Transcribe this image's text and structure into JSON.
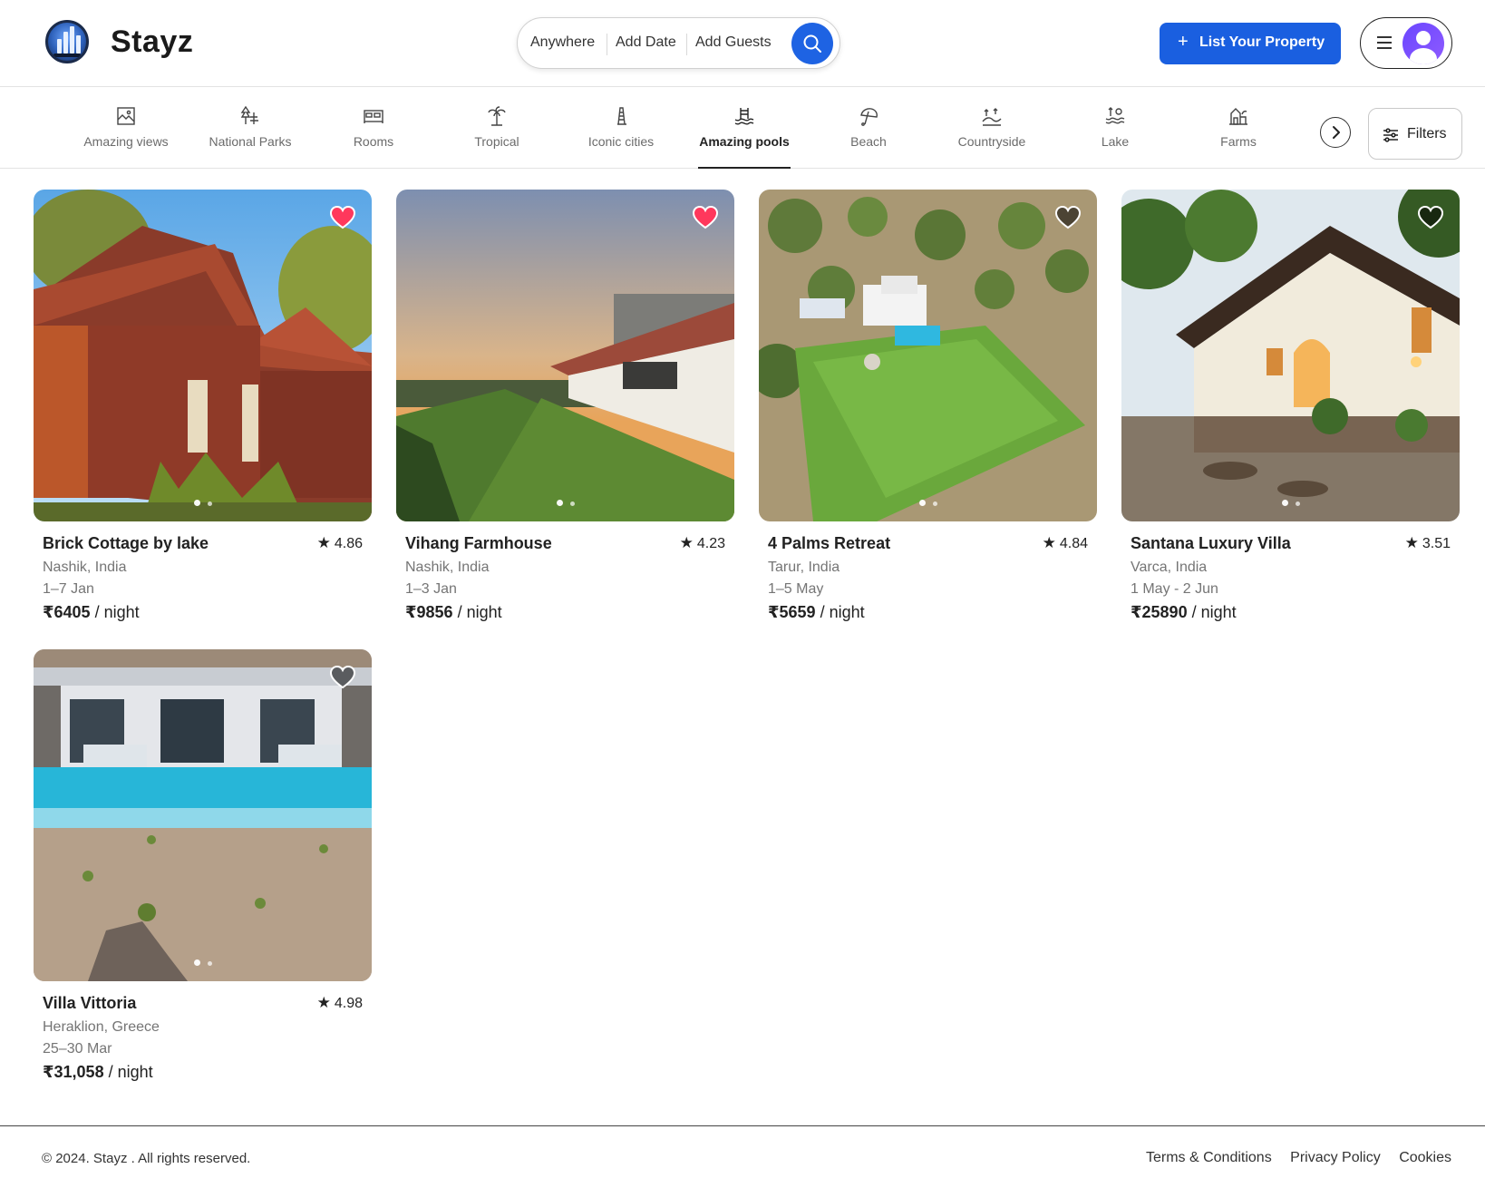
{
  "header": {
    "brand": "Stayz",
    "search": {
      "where": "Anywhere",
      "date": "Add Date",
      "guests": "Add Guests"
    },
    "list_property": "List Your Property"
  },
  "categories": [
    {
      "label": "Amazing views",
      "icon": "picture-icon"
    },
    {
      "label": "National Parks",
      "icon": "trees-icon"
    },
    {
      "label": "Rooms",
      "icon": "bed-icon"
    },
    {
      "label": "Tropical",
      "icon": "palm-icon"
    },
    {
      "label": "Iconic cities",
      "icon": "tower-icon"
    },
    {
      "label": "Amazing pools",
      "icon": "pool-icon",
      "active": true
    },
    {
      "label": "Beach",
      "icon": "umbrella-icon"
    },
    {
      "label": "Countryside",
      "icon": "hills-icon"
    },
    {
      "label": "Lake",
      "icon": "lake-icon"
    },
    {
      "label": "Farms",
      "icon": "farm-icon"
    }
  ],
  "filters_label": "Filters",
  "listings": [
    {
      "title": "Brick Cottage by lake",
      "rating": "4.86",
      "location": "Nashik, India",
      "dates": "1–7 Jan",
      "price": "₹6405",
      "per": " / night",
      "favorite": true
    },
    {
      "title": "Vihang Farmhouse",
      "rating": "4.23",
      "location": "Nashik, India",
      "dates": "1–3 Jan",
      "price": "₹9856",
      "per": " / night",
      "favorite": true
    },
    {
      "title": "4 Palms Retreat",
      "rating": "4.84",
      "location": "Tarur, India",
      "dates": "1–5 May",
      "price": "₹5659",
      "per": " / night",
      "favorite": false
    },
    {
      "title": "Santana Luxury Villa",
      "rating": "3.51",
      "location": "Varca, India",
      "dates": "1 May - 2 Jun",
      "price": "₹25890",
      "per": " / night",
      "favorite": false
    },
    {
      "title": "Villa Vittoria",
      "rating": "4.98",
      "location": "Heraklion, Greece",
      "dates": "25–30 Mar",
      "price": "₹31,058",
      "per": " / night",
      "favorite": false
    }
  ],
  "footer": {
    "copyright": "© 2024. Stayz . All rights reserved.",
    "links": [
      "Terms & Conditions",
      "Privacy Policy",
      "Cookies"
    ]
  },
  "colors": {
    "accent": "#1a5fe0",
    "favorite": "#ff385c"
  }
}
